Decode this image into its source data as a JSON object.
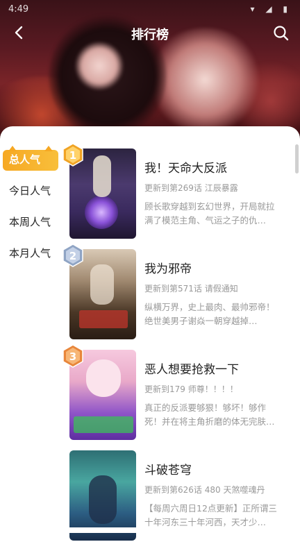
{
  "status": {
    "time": "4:49",
    "icons": "▾ ◢ ▮"
  },
  "nav": {
    "title": "排行榜"
  },
  "tabs": [
    {
      "label": "总人气",
      "active": true
    },
    {
      "label": "今日人气",
      "active": false
    },
    {
      "label": "本周人气",
      "active": false
    },
    {
      "label": "本月人气",
      "active": false
    }
  ],
  "ranking": [
    {
      "rank": "1",
      "title": "我！天命大反派",
      "update": "更新到第269话 江辰暴露",
      "desc": "顾长歌穿越到玄幻世界，开局就拉满了模范主角、气运之子的仇…",
      "badge_color": "#f0a324"
    },
    {
      "rank": "2",
      "title": "我为邪帝",
      "update": "更新到第571话 请假通知",
      "desc": "纵横万界，史上最肉、最帅邪帝！绝世美男子谢焱一朝穿越掉…",
      "badge_color": "#8fa4c4"
    },
    {
      "rank": "3",
      "title": "恶人想要抢救一下",
      "update": "更新到179 师尊！！！！",
      "desc": "真正的反派要够狠！够坏！够作死！并在将主角折磨的体无完肤…",
      "badge_color": "#e8863b"
    },
    {
      "rank": "",
      "title": "斗破苍穹",
      "update": "更新到第626话 480 天煞噬魂丹",
      "desc": "【每周六周日12点更新】正所谓三十年河东三十年河西，天才少…",
      "badge_color": ""
    }
  ]
}
